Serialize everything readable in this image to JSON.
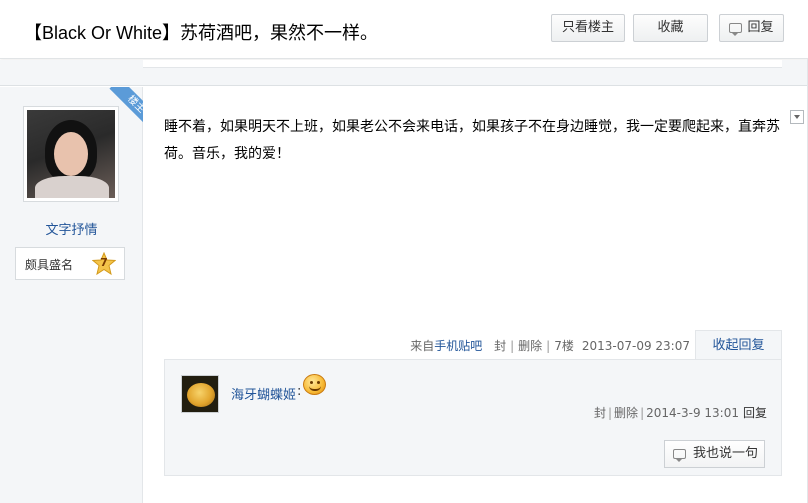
{
  "header": {
    "title": "【Black Or White】苏荷酒吧，果然不一样。",
    "only_author_label": "只看楼主",
    "favorite_label": "收藏",
    "reply_label": "回复"
  },
  "author": {
    "badge": "楼主",
    "name": "文字抒情",
    "rank_title": "颇具盛名",
    "rank_level": "7"
  },
  "post": {
    "content": "睡不着，如果明天不上班，如果老公不会来电话，如果孩子不在身边睡觉，我一定要爬起来，直奔苏荷。音乐，我的爱！",
    "source_prefix": "来自",
    "source_link": "手机贴吧",
    "block_label": "封",
    "delete_label": "删除",
    "floor": "7楼",
    "time": "2013-07-09 23:07",
    "collapse_reply_label": "收起回复"
  },
  "lzl": {
    "reply_user": "海牙蝴蝶姬",
    "colon": ":",
    "emoji_icon": "smiley-emoji",
    "block_label": "封",
    "delete_label": "删除",
    "time": "2014-3-9 13:01",
    "reply_label": "回复",
    "say_label": "我也说一句"
  }
}
